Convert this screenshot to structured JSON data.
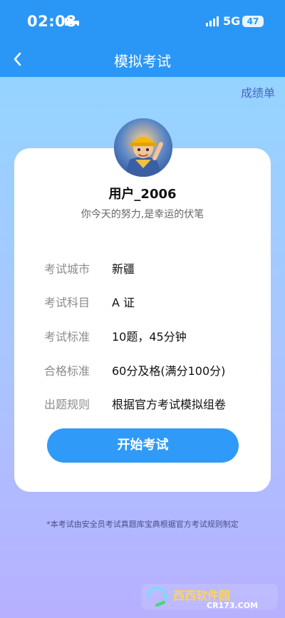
{
  "status_bar": {
    "time": "02:08",
    "network": "5G",
    "battery": "47"
  },
  "header": {
    "title": "模拟考试",
    "back_icon": "chevron-left-icon"
  },
  "scorecard_label": "成绩单",
  "profile": {
    "username": "用户_2006",
    "motto": "你今天的努力,是幸运的伏笔"
  },
  "exam_info": [
    {
      "label": "考试城市",
      "value": "新疆"
    },
    {
      "label": "考试科目",
      "value": "A 证"
    },
    {
      "label": "考试标准",
      "value": "10题，45分钟"
    },
    {
      "label": "合格标准",
      "value": "60分及格(满分100分)"
    },
    {
      "label": "出题规则",
      "value": "根据官方考试模拟组卷"
    }
  ],
  "start_button": "开始考试",
  "footer_note": "*本考试由安全员考试真题库宝典根据官方考试规则制定",
  "watermark": {
    "brand": "西西软件园",
    "domain": "CR173.COM"
  },
  "colors": {
    "primary": "#2a97f6",
    "button": "#2f9af7",
    "accent_text": "#4e64c6"
  }
}
